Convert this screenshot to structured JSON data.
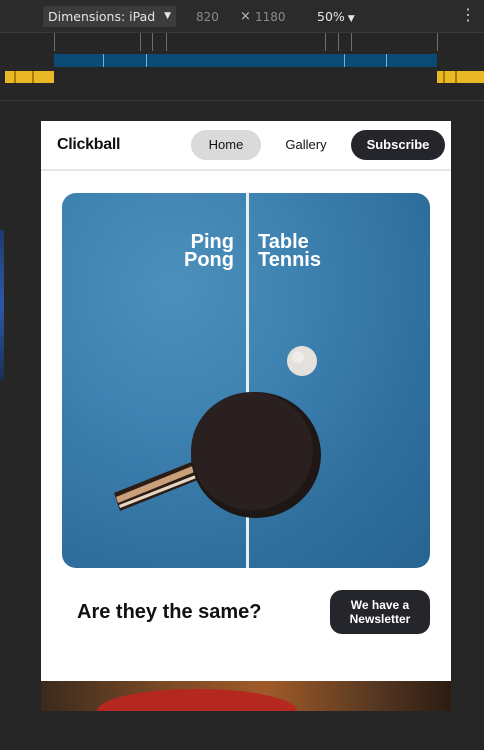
{
  "devtools": {
    "dimensions_label": "Dimensions: iPad Air",
    "width": "820",
    "times": "×",
    "height": "1180",
    "zoom": "50%",
    "more_icon": "⋮"
  },
  "site": {
    "logo": "Clickball",
    "nav": {
      "home": "Home",
      "gallery": "Gallery",
      "subscribe": "Subscribe"
    },
    "hero": {
      "left_line1": "Ping",
      "left_line2": "Pong",
      "right_line1": "Table",
      "right_line2": "Tennis"
    },
    "question": "Are they the same?",
    "newsletter_line1": "We have a",
    "newsletter_line2": "Newsletter"
  },
  "colors": {
    "toolbar_bg": "#2b2b2b",
    "dark_button": "#24262c",
    "table_blue": "#3e82b1",
    "media_bar_blue": "#0b4a75",
    "media_bar_orange": "#e9b824"
  }
}
